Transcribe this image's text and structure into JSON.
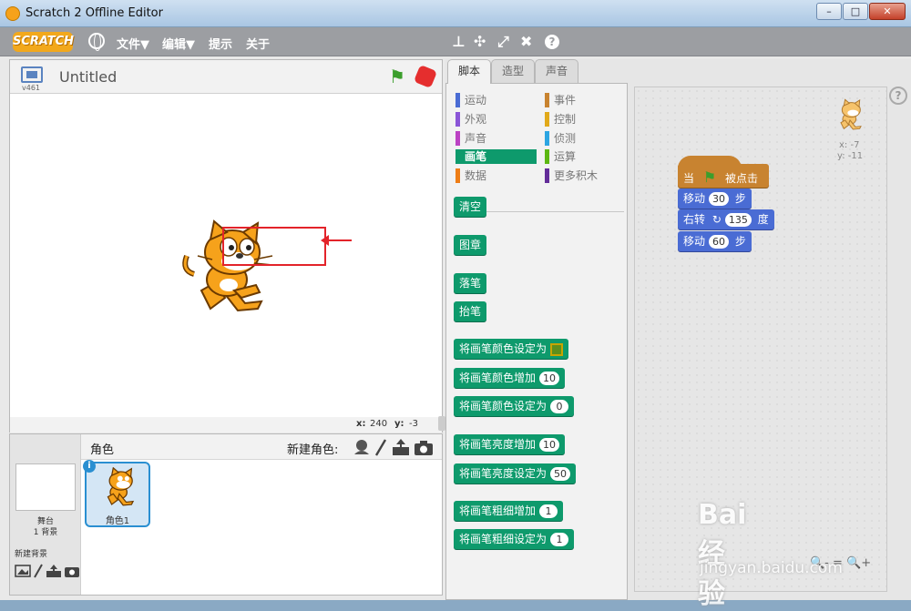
{
  "window": {
    "title": "Scratch 2 Offline Editor",
    "minimize": "–",
    "maximize": "□",
    "close": "✕"
  },
  "menubar": {
    "logo": "SCRATCH",
    "items": [
      "文件▼",
      "编辑▼",
      "提示",
      "关于"
    ],
    "tools": [
      "⊥",
      "✣",
      "⤢",
      "✖",
      "?"
    ]
  },
  "stage": {
    "version": "v461",
    "project_title": "Untitled",
    "x_label": "x:",
    "x_value": "240",
    "y_label": "y:",
    "y_value": "-3"
  },
  "sprites": {
    "header": "角色",
    "new_sprite_label": "新建角色:",
    "stage_label": "舞台",
    "stage_backdrops": "1 背景",
    "new_backdrop_label": "新建背景",
    "sprite_name": "角色1",
    "info": "i"
  },
  "tabs": [
    "脚本",
    "造型",
    "声音"
  ],
  "categories": [
    {
      "label": "运动",
      "color": "#4a6cd4"
    },
    {
      "label": "事件",
      "color": "#c88330"
    },
    {
      "label": "外观",
      "color": "#8a55d7"
    },
    {
      "label": "控制",
      "color": "#e1a91a"
    },
    {
      "label": "声音",
      "color": "#bb42c3"
    },
    {
      "label": "侦测",
      "color": "#2ca5e2"
    },
    {
      "label": "画笔",
      "color": "#0e9a6c"
    },
    {
      "label": "运算",
      "color": "#5cb712"
    },
    {
      "label": "数据",
      "color": "#ee7d16"
    },
    {
      "label": "更多积木",
      "color": "#632d99"
    }
  ],
  "pen_blocks": [
    {
      "label": "清空",
      "value": null
    },
    {
      "label": "图章",
      "value": null
    },
    {
      "label": "落笔",
      "value": null
    },
    {
      "label": "抬笔",
      "value": null
    },
    {
      "label": "将画笔颜色设定为",
      "value": "color"
    },
    {
      "label": "将画笔颜色增加",
      "value": "10"
    },
    {
      "label": "将画笔颜色设定为",
      "value": "0"
    },
    {
      "label": "将画笔亮度增加",
      "value": "10"
    },
    {
      "label": "将画笔亮度设定为",
      "value": "50"
    },
    {
      "label": "将画笔粗细增加",
      "value": "1"
    },
    {
      "label": "将画笔粗细设定为",
      "value": "1"
    }
  ],
  "script": {
    "sprite_x": "x: -7",
    "sprite_y": "y: -11",
    "hat": {
      "prefix": "当",
      "suffix": "被点击"
    },
    "move1": {
      "label": "移动",
      "value": "30",
      "unit": "步"
    },
    "turn": {
      "label": "右转",
      "icon": "↻",
      "value": "135",
      "unit": "度"
    },
    "move2": {
      "label": "移动",
      "value": "60",
      "unit": "步"
    }
  },
  "zoom": {
    "out": "🔍-",
    "reset": "=",
    "in": "🔍+"
  },
  "watermark": {
    "brand": "Bai 经验",
    "url": "jingyan.baidu.com"
  }
}
